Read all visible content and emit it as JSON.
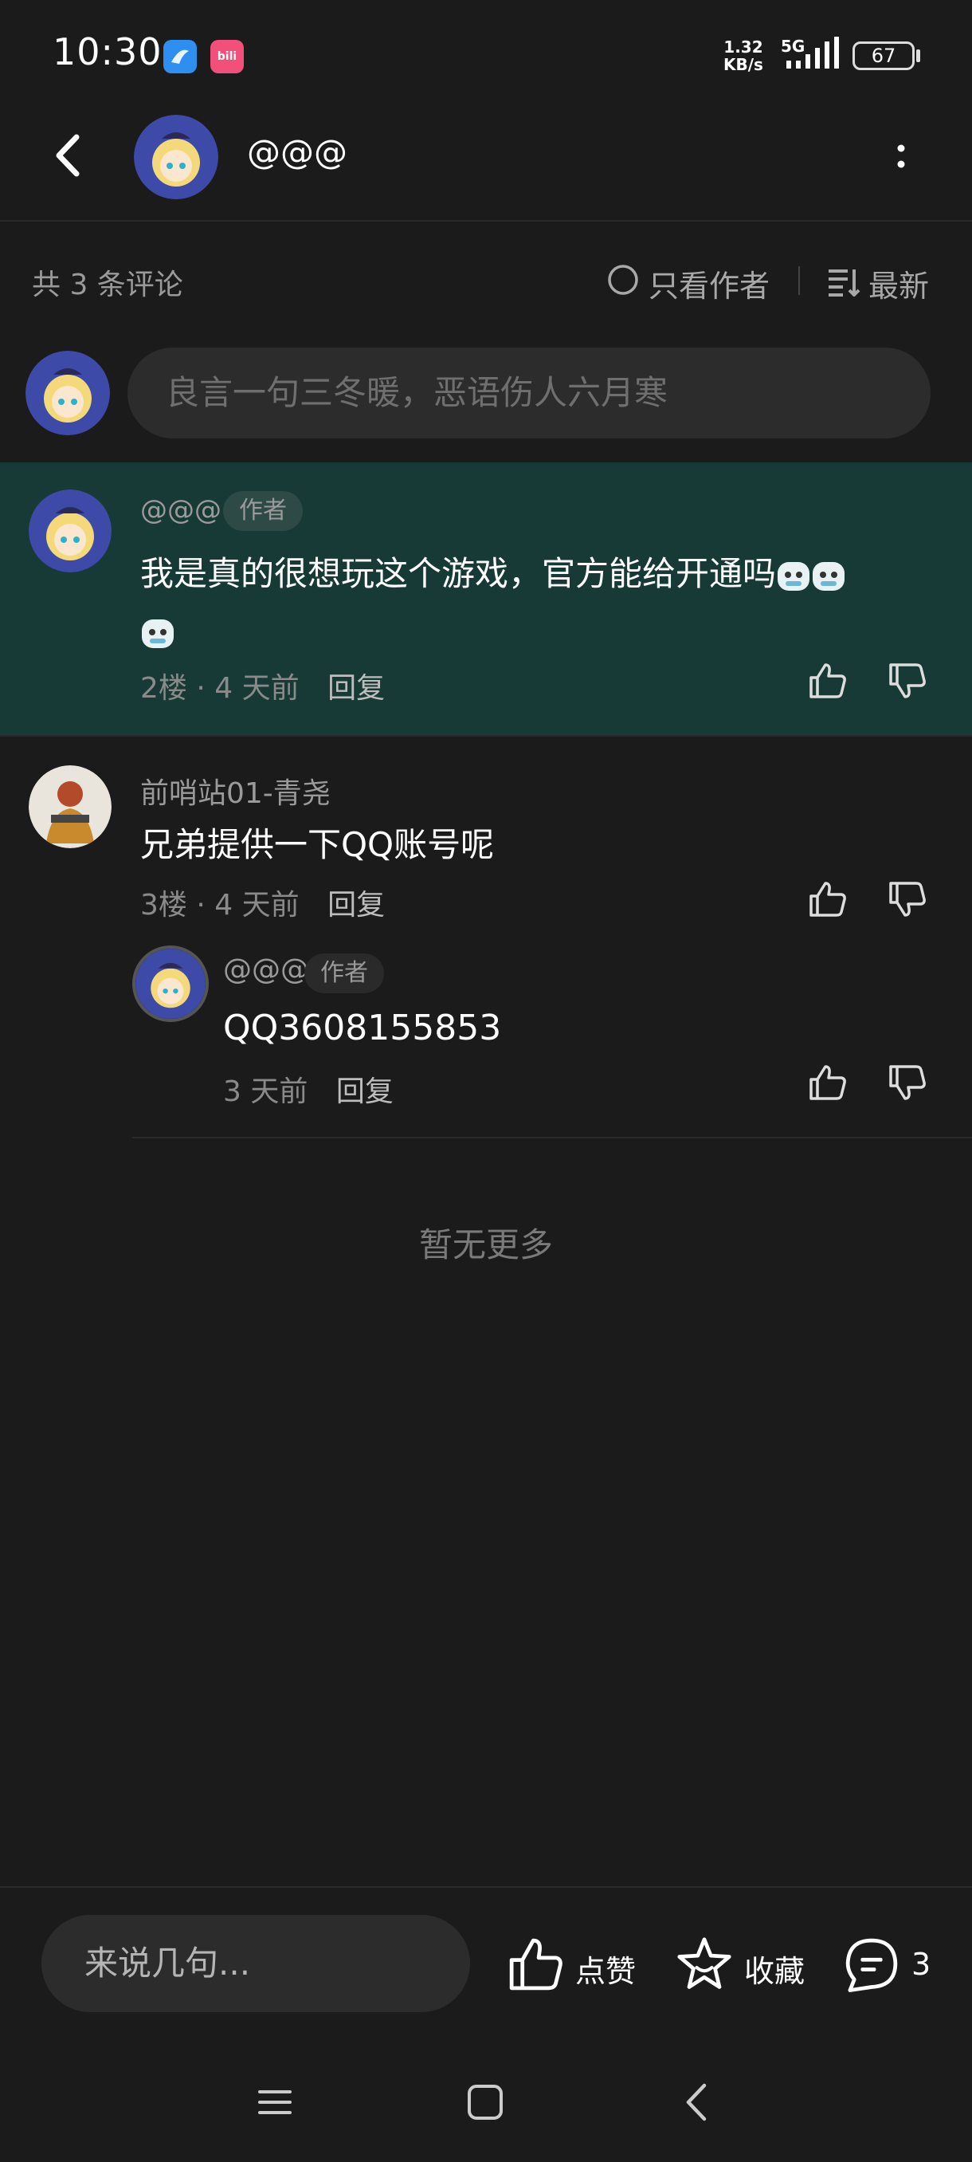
{
  "status_bar": {
    "time": "10:30",
    "net_speed_value": "1.32",
    "net_speed_unit": "KB/s",
    "network": "5G",
    "battery": "67"
  },
  "header": {
    "title": "@@@"
  },
  "filter": {
    "comment_count": "共 3 条评论",
    "only_author": "只看作者",
    "sort": "最新"
  },
  "composer": {
    "placeholder": "良言一句三冬暖，恶语伤人六月寒"
  },
  "comments": [
    {
      "user": "@@@",
      "tag": "作者",
      "text": "我是真的很想玩这个游戏，官方能给开通吗",
      "floor": "2楼",
      "time": "4 天前",
      "reply": "回复"
    },
    {
      "user": "前哨站01-青尧",
      "text": "兄弟提供一下QQ账号呢",
      "floor": "3楼",
      "time": "4 天前",
      "reply": "回复",
      "replies": [
        {
          "user": "@@@",
          "tag": "作者",
          "text": "QQ3608155853",
          "time": "3 天前",
          "reply": "回复"
        }
      ]
    }
  ],
  "footer_note": "暂无更多",
  "bottom_bar": {
    "input_placeholder": "来说几句...",
    "like_label": "点赞",
    "fav_label": "收藏",
    "comment_count": "3"
  },
  "colors": {
    "background": "#1b1b1b",
    "highlight": "#173a36",
    "input_bg": "#2c2c2c"
  }
}
